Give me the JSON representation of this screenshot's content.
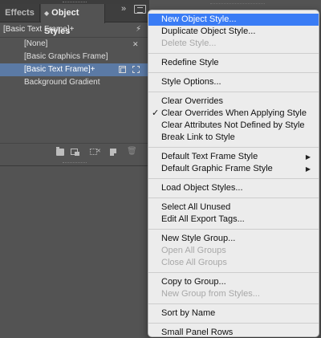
{
  "panel": {
    "tabs": [
      {
        "label": "Effects"
      },
      {
        "label": "Object Styles"
      }
    ],
    "current_style": "[Basic Text Frame]+",
    "styles": [
      {
        "label": "[None]"
      },
      {
        "label": "[Basic Graphics Frame]"
      },
      {
        "label": "[Basic Text Frame]+"
      },
      {
        "label": "Background Gradient"
      }
    ],
    "collapse_glyph": "»"
  },
  "menu": {
    "groups": [
      [
        {
          "label": "New Object Style...",
          "state": "highlighted"
        },
        {
          "label": "Duplicate Object Style...",
          "state": "normal"
        },
        {
          "label": "Delete Style...",
          "state": "disabled"
        }
      ],
      [
        {
          "label": "Redefine Style",
          "state": "normal"
        }
      ],
      [
        {
          "label": "Style Options...",
          "state": "normal"
        }
      ],
      [
        {
          "label": "Clear Overrides",
          "state": "normal"
        },
        {
          "label": "Clear Overrides When Applying Style",
          "state": "checked"
        },
        {
          "label": "Clear Attributes Not Defined by Style",
          "state": "normal"
        },
        {
          "label": "Break Link to Style",
          "state": "normal"
        }
      ],
      [
        {
          "label": "Default Text Frame Style",
          "state": "submenu"
        },
        {
          "label": "Default Graphic Frame Style",
          "state": "submenu"
        }
      ],
      [
        {
          "label": "Load Object Styles...",
          "state": "normal"
        }
      ],
      [
        {
          "label": "Select All Unused",
          "state": "normal"
        },
        {
          "label": "Edit All Export Tags...",
          "state": "normal"
        }
      ],
      [
        {
          "label": "New Style Group...",
          "state": "normal"
        },
        {
          "label": "Open All Groups",
          "state": "disabled"
        },
        {
          "label": "Close All Groups",
          "state": "disabled"
        }
      ],
      [
        {
          "label": "Copy to Group...",
          "state": "normal"
        },
        {
          "label": "New Group from Styles...",
          "state": "disabled"
        }
      ],
      [
        {
          "label": "Sort by Name",
          "state": "normal"
        }
      ],
      [
        {
          "label": "Small Panel Rows",
          "state": "normal"
        }
      ]
    ],
    "check_glyph": "✓",
    "submenu_glyph": "▶"
  },
  "colors": {
    "panel_bg": "#535353",
    "selection": "#5b7aa5",
    "menu_bg": "#ececec",
    "menu_highlight": "#3a7cf5"
  },
  "icons": [
    "lightning-icon",
    "pencil-x-icon",
    "frame-grid-icon",
    "dashed-frame-icon",
    "folder-icon",
    "clear-overrides-icon",
    "clear-attributes-icon",
    "new-style-icon",
    "trash-icon",
    "panel-menu-icon"
  ]
}
